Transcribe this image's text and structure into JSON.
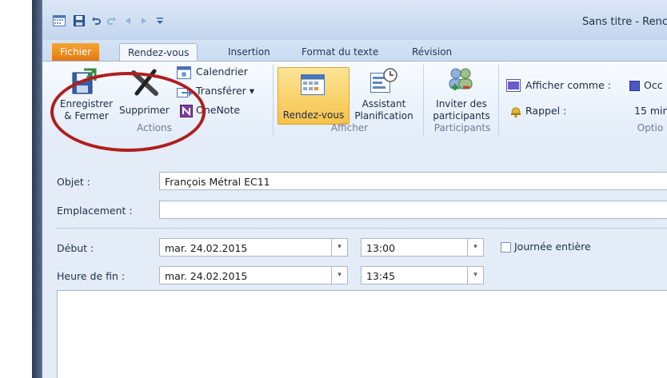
{
  "window": {
    "title": "Sans titre - Renc"
  },
  "tabs": [
    {
      "label": "Fichier"
    },
    {
      "label": "Rendez-vous"
    },
    {
      "label": "Insertion"
    },
    {
      "label": "Format du texte"
    },
    {
      "label": "Révision"
    }
  ],
  "ribbon": {
    "actions": {
      "label": "Actions",
      "save_close_line1": "Enregistrer",
      "save_close_line2": "& Fermer",
      "delete": "Supprimer",
      "calendar": "Calendrier",
      "forward": "Transférer ▾",
      "onenote": "OneNote"
    },
    "afficher": {
      "label": "Afficher",
      "appointment": "Rendez-vous",
      "assistant_line1": "Assistant",
      "assistant_line2": "Planification"
    },
    "participants": {
      "label": "Participants",
      "invite_line1": "Inviter des",
      "invite_line2": "participants"
    },
    "options": {
      "label": "Optio",
      "show_as_label": "Afficher comme :",
      "show_as_value": "Occ",
      "reminder_label": "Rappel :",
      "reminder_value": "15 min"
    }
  },
  "form": {
    "subject_label": "Objet :",
    "subject_value": "François Métral EC11",
    "location_label": "Emplacement :",
    "location_value": "",
    "start_label": "Début :",
    "start_date": "mar. 24.02.2015",
    "start_time": "13:00",
    "all_day_label": "Journée entière",
    "end_label": "Heure de fin :",
    "end_date": "mar. 24.02.2015",
    "end_time": "13:45"
  },
  "colors": {
    "fichier_tab": "#e47810",
    "highlight_ring": "#b01e1e",
    "active_button": "#f6c24a"
  }
}
